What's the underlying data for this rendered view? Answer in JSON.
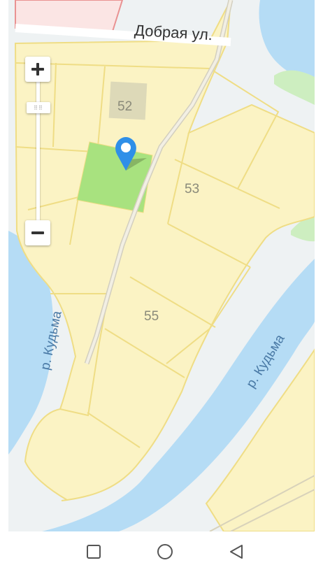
{
  "map": {
    "street_label": "Добрая ул.",
    "river_label_left": "р. Кудьма",
    "river_label_right": "р. Кудьма",
    "plot_numbers": [
      "52",
      "53",
      "55"
    ],
    "marker_icon": "location-pin-icon",
    "colors": {
      "water": "#b5dcf5",
      "plots": "#fbf3c4",
      "plot_border": "#efdd85",
      "highlighted_plot": "#a8e27f",
      "building": "#ddd9b8",
      "marker": "#2f8fe8",
      "park": "#cdeec0"
    }
  },
  "controls": {
    "zoom_in_icon": "plus-icon",
    "zoom_out_icon": "minus-icon",
    "zoom_handle_icon": "grip-icon"
  },
  "nav": {
    "recent_icon": "square-icon",
    "home_icon": "circle-icon",
    "back_icon": "triangle-back-icon"
  }
}
